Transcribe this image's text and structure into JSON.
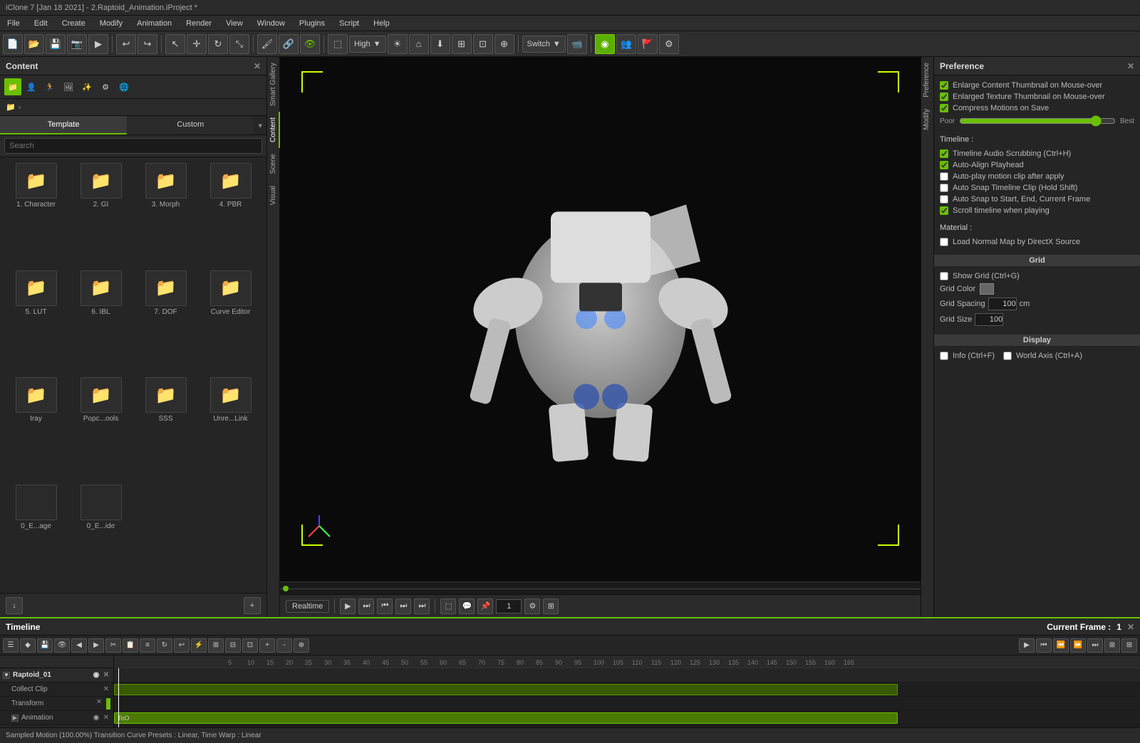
{
  "titlebar": {
    "title": "iClone 7 [Jan 18 2021] - 2.Raptoid_Animation.iProject *"
  },
  "menubar": {
    "items": [
      "File",
      "Edit",
      "Create",
      "Modify",
      "Animation",
      "Render",
      "View",
      "Window",
      "Plugins",
      "Script",
      "Help"
    ]
  },
  "toolbar": {
    "quality_label": "High",
    "switch_label": "Switch"
  },
  "content_panel": {
    "title": "Content",
    "template_tab": "Template",
    "custom_tab": "Custom",
    "search_placeholder": "Search",
    "grid_items": [
      {
        "label": "1. Character"
      },
      {
        "label": "2. GI"
      },
      {
        "label": "3. Morph"
      },
      {
        "label": "4. PBR"
      },
      {
        "label": "5. LUT"
      },
      {
        "label": "6. IBL"
      },
      {
        "label": "7. DOF"
      },
      {
        "label": "Curve Editor"
      },
      {
        "label": "Iray"
      },
      {
        "label": "Popc...ools"
      },
      {
        "label": "SSS"
      },
      {
        "label": "Unre...Link"
      },
      {
        "label": "0_E...age"
      },
      {
        "label": "0_E...ide"
      }
    ]
  },
  "side_tabs": {
    "items": [
      "Smart Gallery",
      "Content",
      "Scene",
      "Visual"
    ]
  },
  "preference_panel": {
    "title": "Preference",
    "checkboxes": [
      {
        "label": "Enlarge Content Thumbnail on Mouse-over",
        "checked": true
      },
      {
        "label": "Enlarged Texture Thumbnail on Mouse-over",
        "checked": true
      },
      {
        "label": "Compress Motions on Save",
        "checked": true
      }
    ],
    "slider": {
      "left_label": "Poor",
      "right_label": "Best"
    },
    "timeline_section": "Timeline :",
    "timeline_checks": [
      {
        "label": "Timeline Audio Scrubbing (Ctrl+H)",
        "checked": true
      },
      {
        "label": "Auto-Align Playhead",
        "checked": true
      },
      {
        "label": "Auto-play motion clip after apply",
        "checked": false
      },
      {
        "label": "Auto Snap Timeline Clip (Hold Shift)",
        "checked": false
      },
      {
        "label": "Auto Snap to Start, End, Current Frame",
        "checked": false
      },
      {
        "label": "Scroll timeline when playing",
        "checked": true
      }
    ],
    "material_section": "Material :",
    "material_check": {
      "label": "Load Normal Map by DirectX Source",
      "checked": false
    },
    "grid_section": "Grid",
    "grid_check": {
      "label": "Show Grid (Ctrl+G)",
      "checked": false
    },
    "grid_color_label": "Grid Color",
    "grid_spacing_label": "Grid Spacing",
    "grid_spacing_val": "100",
    "grid_spacing_unit": "cm",
    "grid_size_label": "Grid Size",
    "grid_size_val": "100",
    "display_section": "Display",
    "display_checks": [
      {
        "label": "Info (Ctrl+F)",
        "checked": false
      },
      {
        "label": "World Axis (Ctrl+A)",
        "checked": false
      }
    ]
  },
  "right_side_tabs": [
    "Preference",
    "Modify"
  ],
  "playback": {
    "mode_label": "Realtime",
    "frame_val": "1"
  },
  "timeline": {
    "title": "Timeline",
    "current_frame_label": "Current Frame :",
    "current_frame_val": "1",
    "tracks": [
      {
        "name": "Raptoid_01",
        "type": "parent"
      },
      {
        "name": "Collect Clip",
        "type": "child"
      },
      {
        "name": "Transform",
        "type": "child"
      },
      {
        "name": "Animation",
        "type": "child"
      }
    ],
    "status": "Sampled Motion (100.00%) Transition Curve Presets : Linear, Time Warp : Linear",
    "ruler_marks": [
      "5",
      "10",
      "15",
      "20",
      "25",
      "30",
      "35",
      "40",
      "45",
      "50",
      "55",
      "60",
      "65",
      "70",
      "75",
      "80",
      "85",
      "90",
      "95",
      "100",
      "105",
      "110",
      "115",
      "120",
      "125",
      "130",
      "135",
      "140",
      "145",
      "150",
      "155",
      "160",
      "165"
    ],
    "too_label": "ToO"
  }
}
